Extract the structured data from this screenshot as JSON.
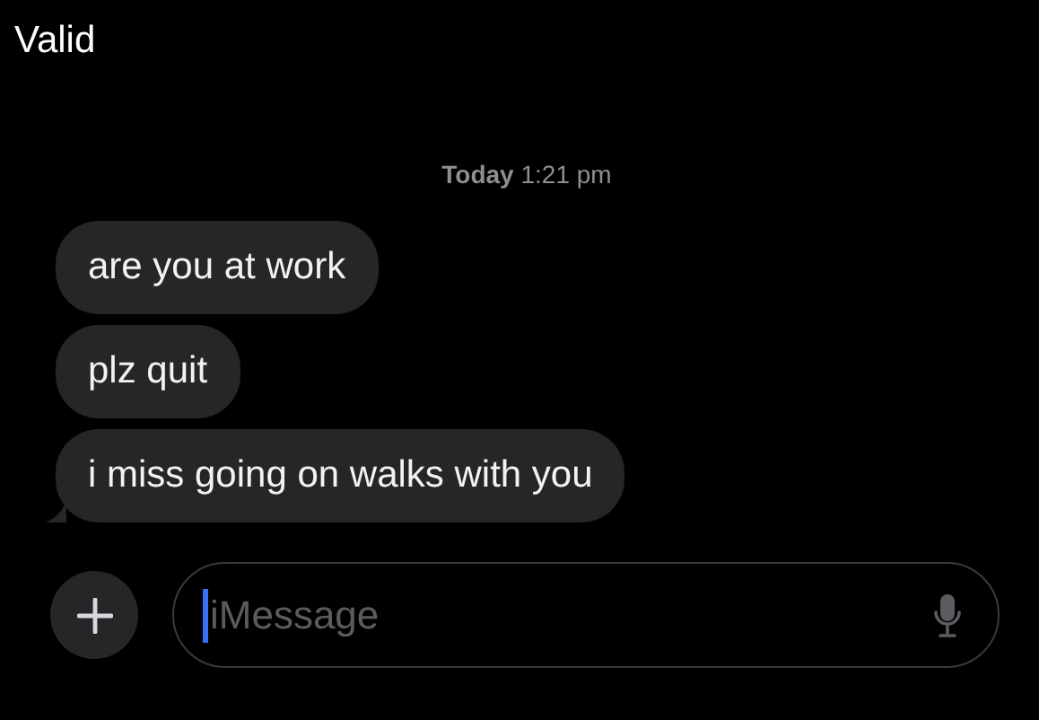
{
  "header": {
    "title": "Valid"
  },
  "timestamp": "**Today** 1:21 pm",
  "messages": [
    {
      "text": "are you at work",
      "tail": false
    },
    {
      "text": "plz quit",
      "tail": false
    },
    {
      "text": "i miss going on walks with you",
      "tail": true
    }
  ],
  "composer": {
    "placeholder": "iMessage"
  }
}
